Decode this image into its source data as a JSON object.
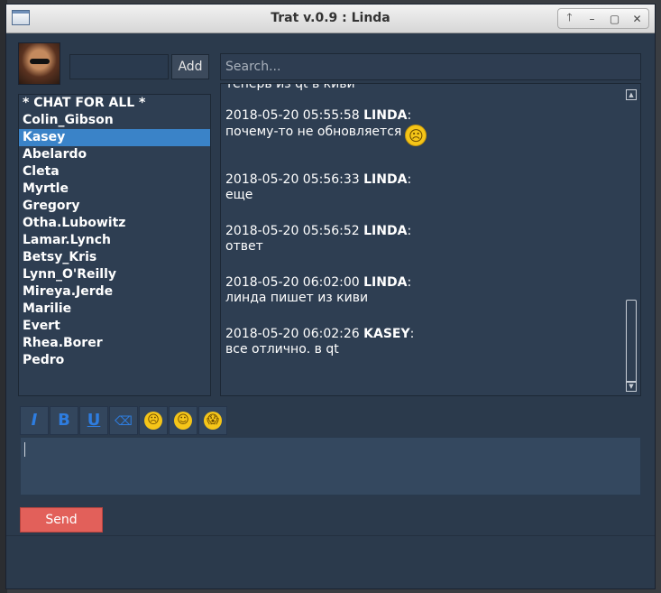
{
  "window": {
    "title": "Trat v.0.9 : Linda"
  },
  "wm_buttons": [
    "🡑",
    "–",
    "▢",
    "✕"
  ],
  "add_button": "Add",
  "search_placeholder": "Search...",
  "users": [
    "* CHAT FOR ALL *",
    "Colin_Gibson",
    "Kasey",
    "Abelardo",
    "Cleta",
    "Myrtle",
    "Gregory",
    "Otha.Lubowitz",
    "Lamar.Lynch",
    "Betsy_Kris",
    "Lynn_O'Reilly",
    "Mireya.Jerde",
    "Marilie",
    "Evert",
    "Rhea.Borer",
    "Pedro"
  ],
  "selected_user": "Kasey",
  "messages": [
    {
      "time": "2018-05-20 05:55:58",
      "author": "LINDA",
      "text": "почему-то не обновляется",
      "emoji": "frown"
    },
    {
      "time": "2018-05-20 05:56:33",
      "author": "LINDA",
      "text": "еще"
    },
    {
      "time": "2018-05-20 05:56:52",
      "author": "LINDA",
      "text": "ответ"
    },
    {
      "time": "2018-05-20 06:02:00",
      "author": "LINDA",
      "text": "линда пишет из киви"
    },
    {
      "time": "2018-05-20 06:02:26",
      "author": "KASEY",
      "text": "все отлично. в qt"
    }
  ],
  "cut_off_line": "теперь из qt в киви",
  "format_toolbar": [
    {
      "name": "italic-button",
      "label": "I",
      "style": "italic"
    },
    {
      "name": "bold-button",
      "label": "B",
      "style": "bold"
    },
    {
      "name": "underline-button",
      "label": "U",
      "style": "underline"
    },
    {
      "name": "eraser-button",
      "label": "⌫",
      "style": "icon"
    },
    {
      "name": "frown-emoji-button",
      "label": "☹",
      "style": "face"
    },
    {
      "name": "smile-emoji-button",
      "label": "☺",
      "style": "face"
    },
    {
      "name": "shocked-emoji-button",
      "label": "😱",
      "style": "face"
    }
  ],
  "send_button": "Send",
  "colors": {
    "panel": "#2e3e52",
    "selection": "#3a83c8",
    "send": "#e2605a",
    "format_icons": "#2e7de0"
  }
}
